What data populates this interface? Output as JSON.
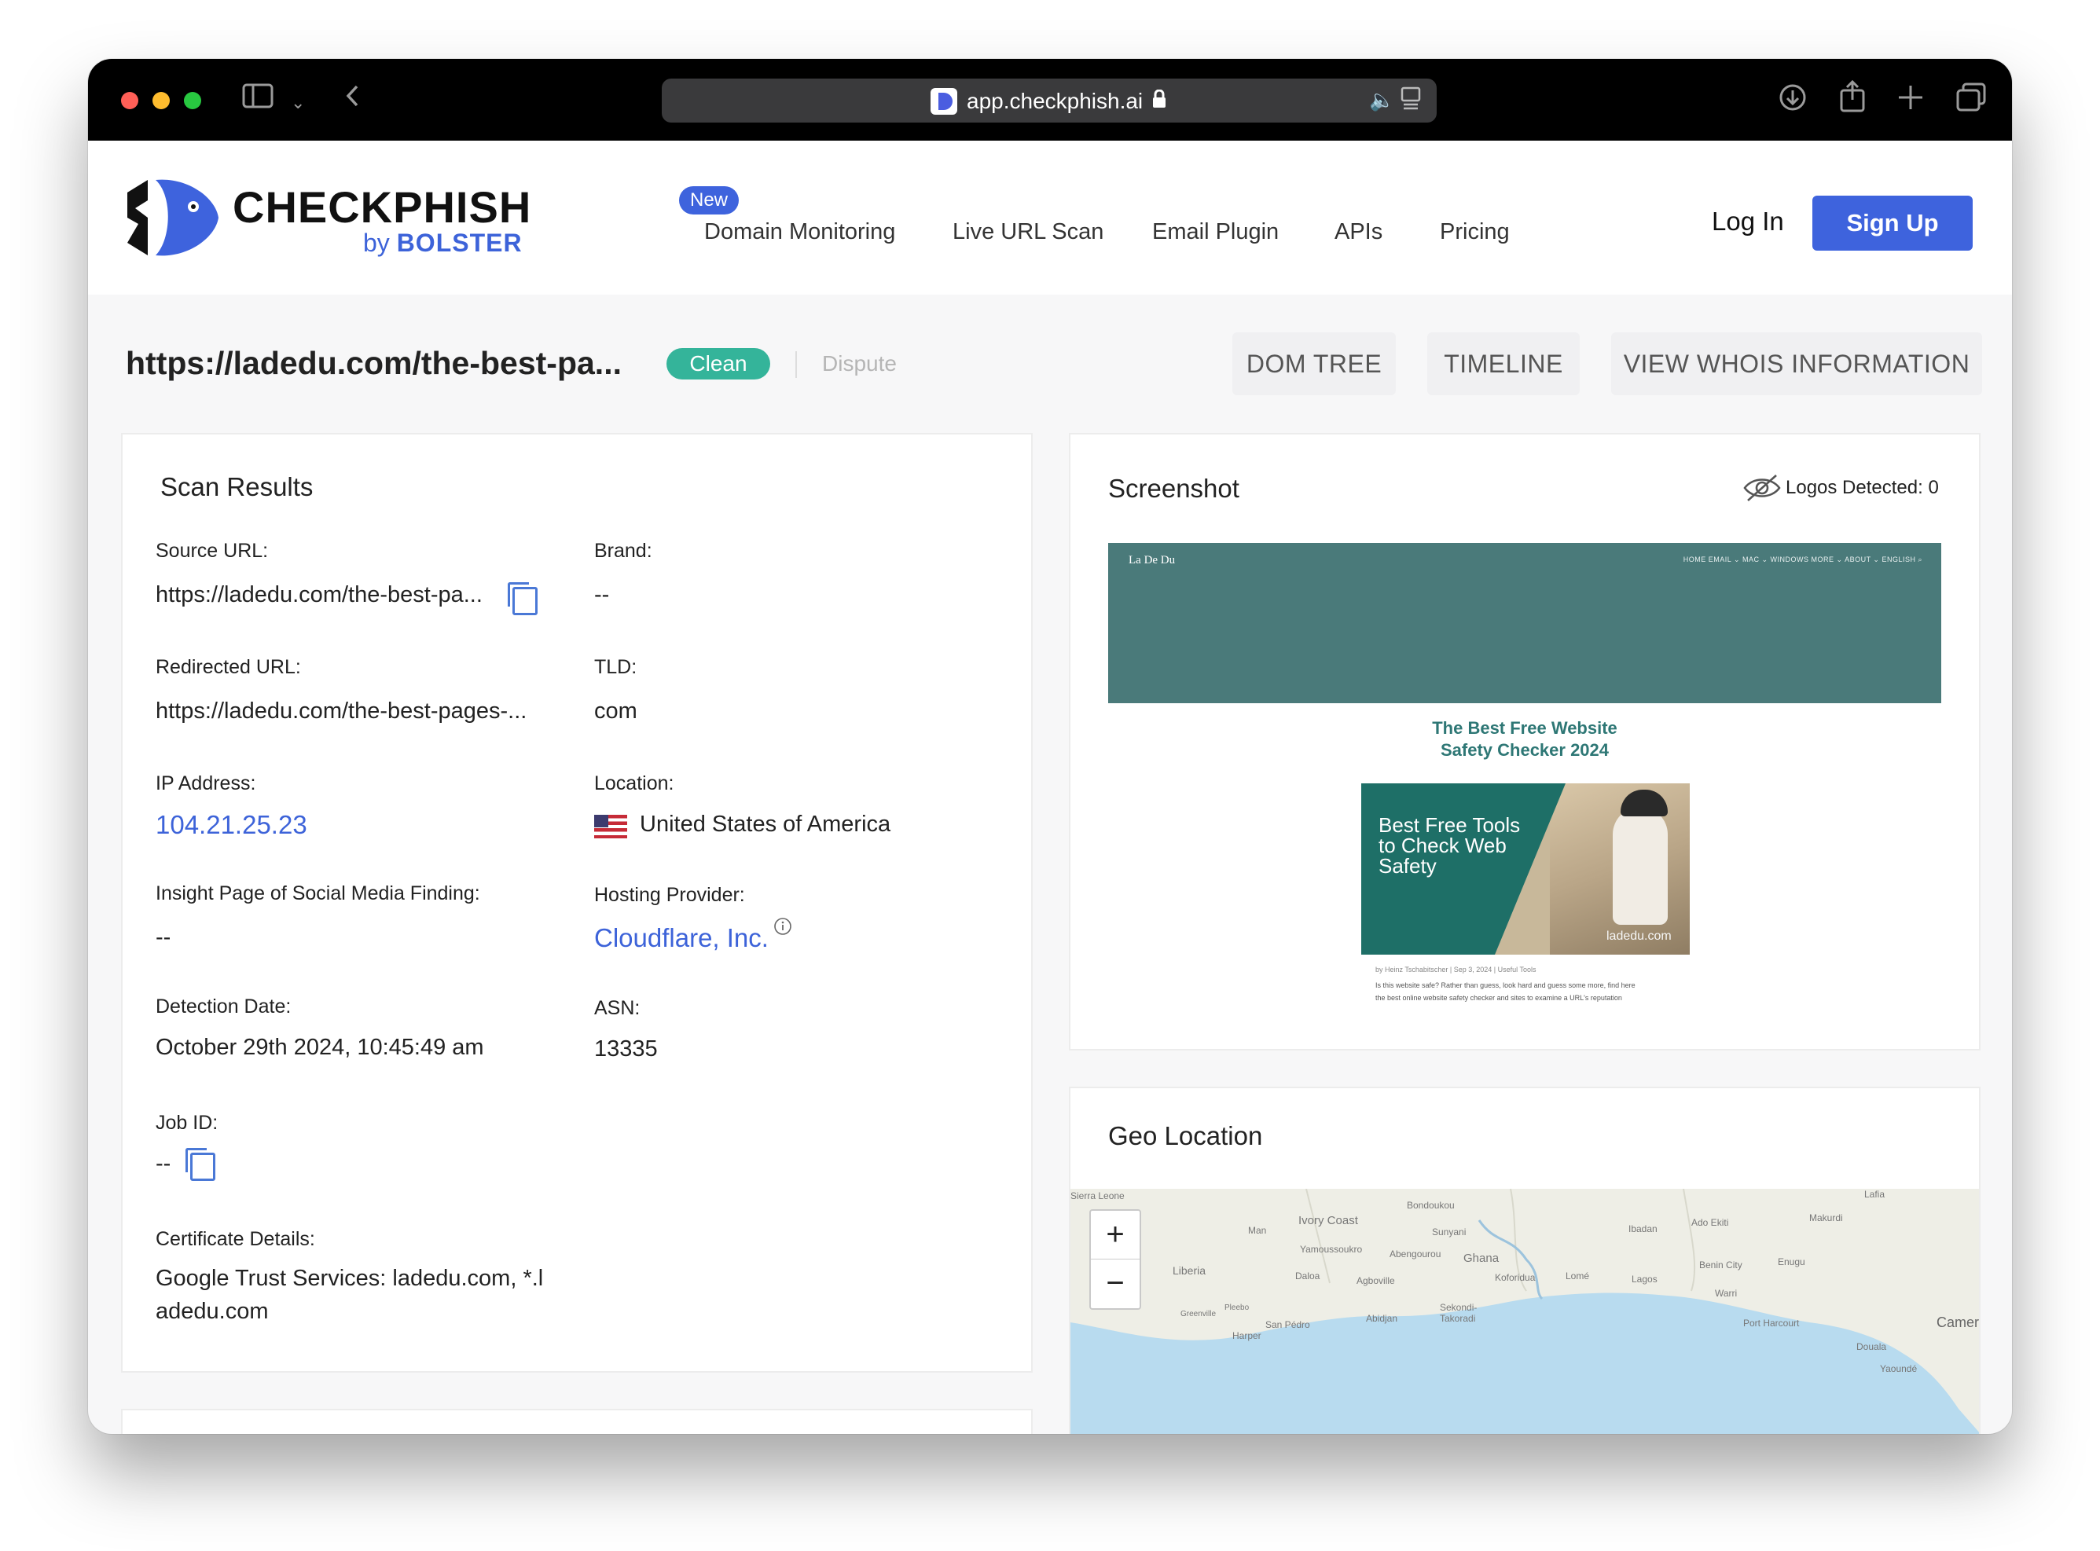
{
  "browser": {
    "url": "app.checkphish.ai"
  },
  "header": {
    "logo_title": "CHECKPHISH",
    "logo_by": "by",
    "logo_brand": "BOLSTER",
    "new_badge": "New",
    "nav": [
      "Domain Monitoring",
      "Live URL Scan",
      "Email Plugin",
      "APIs",
      "Pricing"
    ],
    "login": "Log In",
    "signup": "Sign Up"
  },
  "scan": {
    "url": "https://ladedu.com/the-best-pa...",
    "status": "Clean",
    "dispute": "Dispute",
    "tabs": [
      "DOM TREE",
      "TIMELINE",
      "VIEW WHOIS INFORMATION"
    ]
  },
  "results": {
    "title": "Scan Results",
    "source_url_label": "Source URL:",
    "source_url": "https://ladedu.com/the-best-pa...",
    "brand_label": "Brand:",
    "brand": "--",
    "redirected_url_label": "Redirected URL:",
    "redirected_url": "https://ladedu.com/the-best-pages-...",
    "tld_label": "TLD:",
    "tld": "com",
    "ip_label": "IP Address:",
    "ip": "104.21.25.23",
    "location_label": "Location:",
    "location": "United States of America",
    "insight_label": "Insight Page of Social Media Finding:",
    "insight": "--",
    "hosting_label": "Hosting Provider:",
    "hosting": "Cloudflare, Inc.",
    "detection_label": "Detection Date:",
    "detection": "October 29th 2024, 10:45:49 am",
    "asn_label": "ASN:",
    "asn": "13335",
    "job_label": "Job ID:",
    "job": "--",
    "cert_label": "Certificate Details:",
    "cert_line1": "Google Trust Services: ladedu.com, *.l",
    "cert_line2": "adedu.com"
  },
  "screenshot": {
    "title": "Screenshot",
    "logos_detected": "Logos Detected: 0",
    "site_brand": "La De Du",
    "site_nav": "HOME   EMAIL ⌄   MAC ⌄   WINDOWS   MORE ⌄   ABOUT ⌄   ENGLISH   ⌕",
    "heading_line1": "The Best Free Website",
    "heading_line2": "Safety Checker 2024",
    "image_text_line1": "Best Free Tools",
    "image_text_line2": "to Check Web",
    "image_text_line3": "Safety",
    "image_watermark": "ladedu.com",
    "byline": "by Heinz Tschabitscher | Sep 3, 2024 | Useful Tools",
    "body_line1": "Is this website safe? Rather than guess, look hard and guess some more, find here",
    "body_line2": "the best online website safety checker and sites to examine a URL's reputation"
  },
  "geo": {
    "title": "Geo Location",
    "zoom_in": "+",
    "zoom_out": "−",
    "labels": [
      "Sierra Leone",
      "Ivory Coast",
      "Ghana",
      "Liberia",
      "Man",
      "Yamoussoukro",
      "Bondoukou",
      "Sunyani",
      "Abengourou",
      "Koforidua",
      "Ibadan",
      "Ado Ekiti",
      "Makurdi",
      "Benin City",
      "Enugu",
      "Lagos",
      "Lomé",
      "Warri",
      "Port Harcourt",
      "Douala",
      "Yaoundé",
      "Abidjan",
      "Sekondi-Takoradi",
      "San Pédro",
      "Greenville",
      "Harper",
      "Pleebo",
      "Cameroon",
      "Daloa",
      "Agboville",
      "Lafia"
    ]
  },
  "colors": {
    "brand_blue": "#3e63dd",
    "clean_green": "#34b49a",
    "link_blue": "#3d63d9",
    "site_teal": "#4a7a7a"
  }
}
